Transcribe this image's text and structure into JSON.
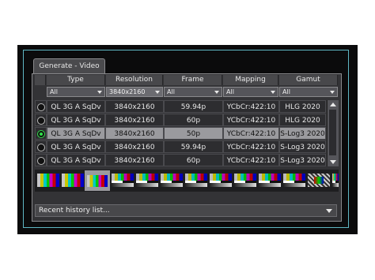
{
  "tab_title": "Generate - Video",
  "columns": [
    "Type",
    "Resolution",
    "Frame",
    "Mapping",
    "Gamut"
  ],
  "filters": [
    "All",
    "3840x2160",
    "All",
    "All",
    "All"
  ],
  "rows": [
    {
      "type": "QL 3G A SqDv",
      "resolution": "3840x2160",
      "frame": "59.94p",
      "mapping": "YCbCr:422:10",
      "gamut": "HLG 2020",
      "selected": false
    },
    {
      "type": "QL 3G A SqDv",
      "resolution": "3840x2160",
      "frame": "60p",
      "mapping": "YCbCr:422:10",
      "gamut": "HLG 2020",
      "selected": false
    },
    {
      "type": "QL 3G A SqDv",
      "resolution": "3840x2160",
      "frame": "50p",
      "mapping": "YCbCr:422:10",
      "gamut": "S-Log3 2020",
      "selected": true
    },
    {
      "type": "QL 3G A SqDv",
      "resolution": "3840x2160",
      "frame": "59.94p",
      "mapping": "YCbCr:422:10",
      "gamut": "S-Log3 2020",
      "selected": false
    },
    {
      "type": "QL 3G A SqDv",
      "resolution": "3840x2160",
      "frame": "60p",
      "mapping": "YCbCr:422:10",
      "gamut": "S-Log3 2020",
      "selected": false
    }
  ],
  "thumbnails": [
    {
      "kind": "color-bars",
      "selected": false
    },
    {
      "kind": "color-bars",
      "selected": false
    },
    {
      "kind": "color-bars",
      "selected": true
    },
    {
      "kind": "test-card",
      "selected": false
    },
    {
      "kind": "test-card",
      "selected": false
    },
    {
      "kind": "test-card",
      "selected": false
    },
    {
      "kind": "test-card",
      "selected": false
    },
    {
      "kind": "test-card",
      "selected": false
    },
    {
      "kind": "test-card",
      "selected": false
    },
    {
      "kind": "test-card",
      "selected": false
    },
    {
      "kind": "test-card",
      "selected": false
    },
    {
      "kind": "hatch-pattern",
      "selected": false
    },
    {
      "kind": "test-card",
      "selected": false
    }
  ],
  "history_label": "Recent history list...",
  "colors": {
    "accent_frame": "#5fb7c4",
    "radio_active": "#30e04a",
    "row_highlight": "#9a9a9e"
  }
}
